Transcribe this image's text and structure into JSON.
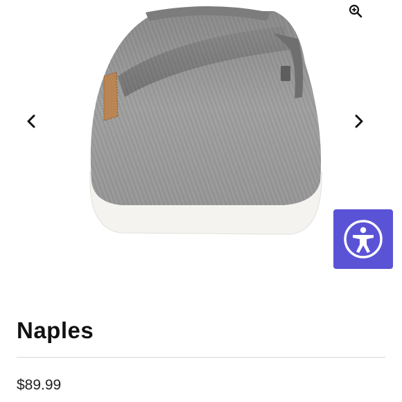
{
  "colors": {
    "accessibility_bg": "#5b53d6",
    "shoe_upper": "#9c9c9c",
    "sole": "#f6f4f1"
  },
  "gallery": {
    "zoom_icon": "zoom-in-icon",
    "prev_icon": "chevron-left-icon",
    "next_icon": "chevron-right-icon"
  },
  "accessibility": {
    "icon": "accessibility-person-icon"
  },
  "product": {
    "title": "Naples",
    "price": "$89.99"
  }
}
